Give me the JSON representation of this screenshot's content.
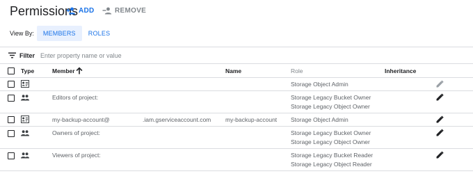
{
  "header": {
    "title": "Permissions",
    "add_label": "ADD",
    "remove_label": "REMOVE"
  },
  "view_by": {
    "label": "View By:",
    "options": [
      "MEMBERS",
      "ROLES"
    ],
    "selected": "MEMBERS"
  },
  "filter": {
    "label": "Filter",
    "placeholder": "Enter property name or value",
    "value": ""
  },
  "table": {
    "columns": {
      "type": "Type",
      "member": "Member",
      "name": "Name",
      "role": "Role",
      "inheritance": "Inheritance"
    },
    "sort": {
      "column": "Member",
      "direction": "ascending"
    },
    "rows": [
      {
        "type_icon": "service-account-icon",
        "member": "",
        "member_suffix": "",
        "name": "",
        "roles": [
          "Storage Object Admin"
        ],
        "edit_icon": "pencil-icon",
        "edit_muted": true
      },
      {
        "type_icon": "group-icon",
        "member": "Editors of project:",
        "member_suffix": "",
        "name": "",
        "roles": [
          "Storage Legacy Bucket Owner",
          "Storage Legacy Object Owner"
        ],
        "edit_icon": "pencil-icon",
        "edit_muted": false
      },
      {
        "type_icon": "service-account-icon",
        "member": "my-backup-account@",
        "member_suffix": ".iam.gserviceaccount.com",
        "name": "my-backup-account",
        "roles": [
          "Storage Object Admin"
        ],
        "edit_icon": "pencil-icon",
        "edit_muted": false
      },
      {
        "type_icon": "group-icon",
        "member": "Owners of project:",
        "member_suffix": "",
        "name": "",
        "roles": [
          "Storage Legacy Bucket Owner",
          "Storage Legacy Object Owner"
        ],
        "edit_icon": "pencil-icon",
        "edit_muted": false
      },
      {
        "type_icon": "group-icon",
        "member": "Viewers of project:",
        "member_suffix": "",
        "name": "",
        "roles": [
          "Storage Legacy Bucket Reader",
          "Storage Legacy Object Reader"
        ],
        "edit_icon": "pencil-icon",
        "edit_muted": false
      }
    ]
  },
  "colors": {
    "accent": "#1a73e8",
    "accent_bg": "#e8f0fe",
    "muted": "#80868b",
    "text": "#202124",
    "divider": "#dadce0"
  }
}
